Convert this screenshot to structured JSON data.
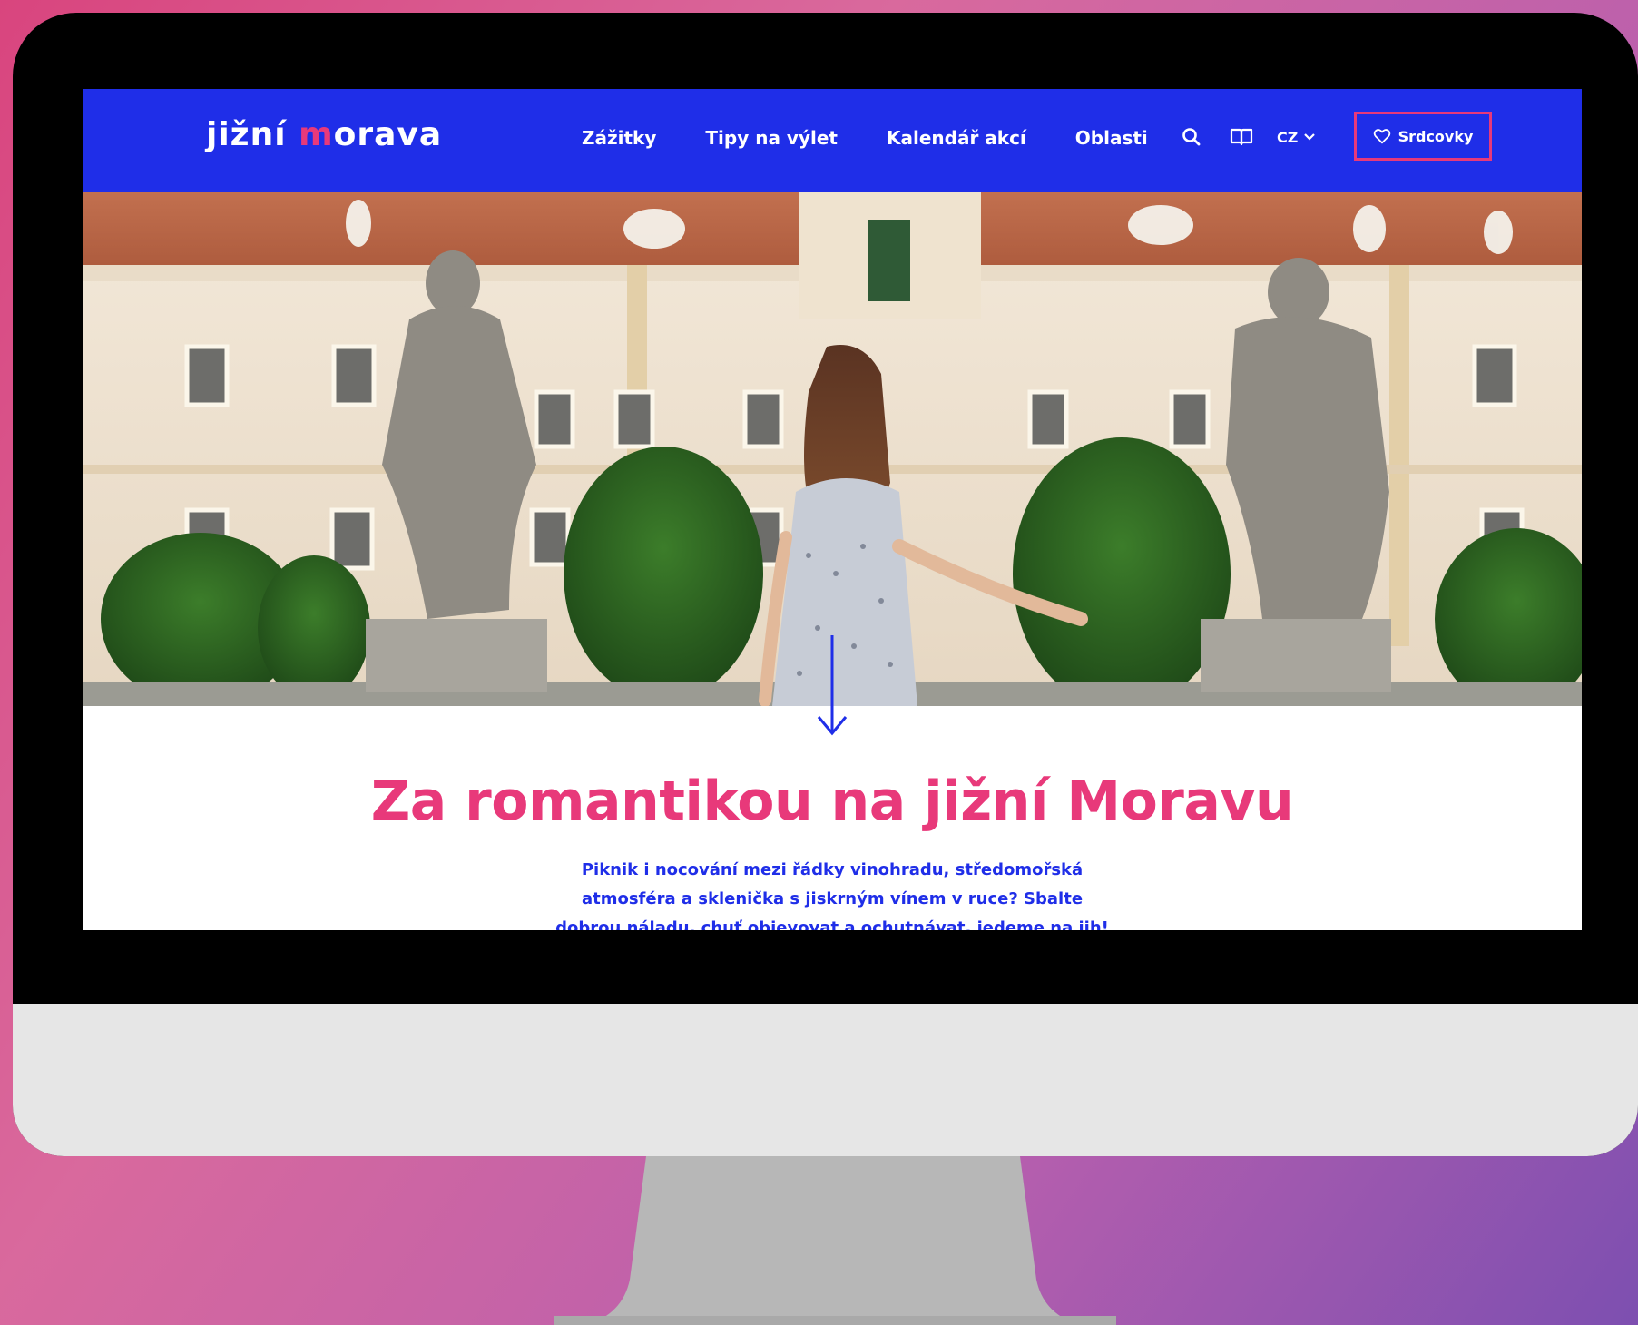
{
  "brand": {
    "logo_part1": "jižní ",
    "logo_m": "m",
    "logo_part2": "orava"
  },
  "nav": {
    "items": [
      {
        "label": "Zážitky"
      },
      {
        "label": "Tipy na výlet"
      },
      {
        "label": "Kalendář akcí"
      },
      {
        "label": "Oblasti"
      }
    ]
  },
  "tools": {
    "search_icon": "search-icon",
    "book_icon": "book-icon",
    "language": "CZ",
    "favorites_label": "Srdcovky"
  },
  "content": {
    "headline": "Za romantikou na jižní Moravu",
    "lead": "Piknik i nocování mezi řádky vinohradu, středomořská atmosféra a sklenička s jiskrným vínem v ruce? Sbalte dobrou náladu, chuť objevovat a ochutnávat, jedeme na jih!"
  },
  "colors": {
    "brand_blue": "#1f2ee8",
    "brand_pink": "#e8397a"
  }
}
